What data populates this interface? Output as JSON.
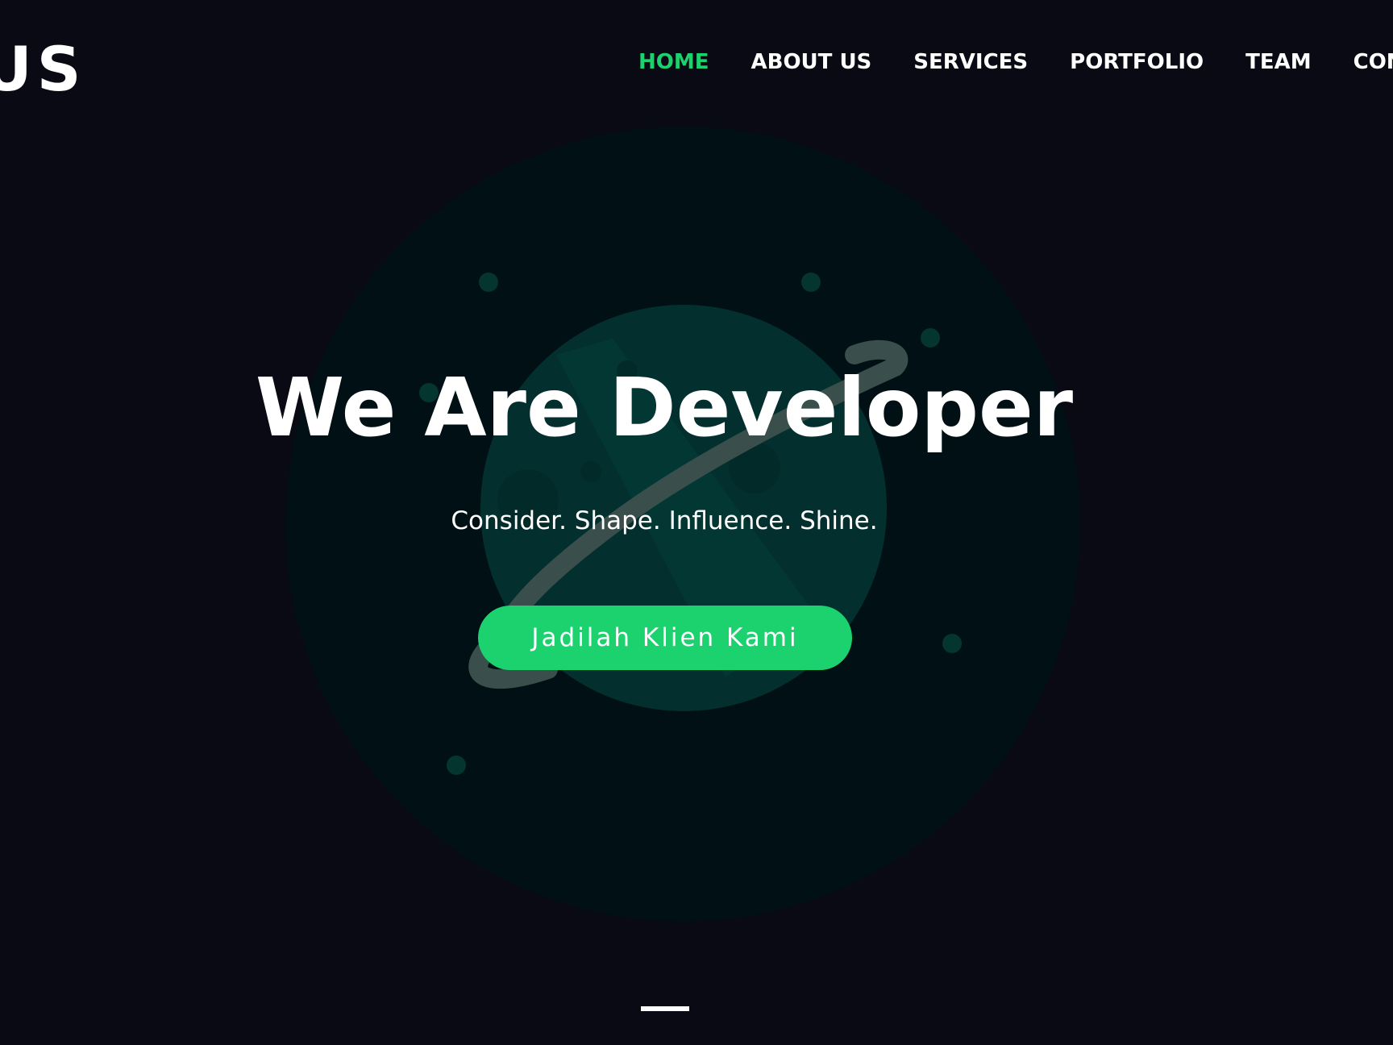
{
  "brand": {
    "logo_text": "US"
  },
  "nav": {
    "items": [
      {
        "label": "HOME",
        "active": true
      },
      {
        "label": "ABOUT US",
        "active": false
      },
      {
        "label": "SERVICES",
        "active": false
      },
      {
        "label": "PORTFOLIO",
        "active": false
      },
      {
        "label": "TEAM",
        "active": false
      },
      {
        "label": "CONT",
        "active": false
      }
    ]
  },
  "hero": {
    "title": "We Are Developer",
    "subtitle": "Consider. Shape. Influence. Shine.",
    "cta_label": "Jadilah Klien Kami",
    "illustration_icon": "planet-icon"
  },
  "colors": {
    "background": "#0a0a14",
    "accent": "#1bd26f",
    "text": "#ffffff"
  }
}
